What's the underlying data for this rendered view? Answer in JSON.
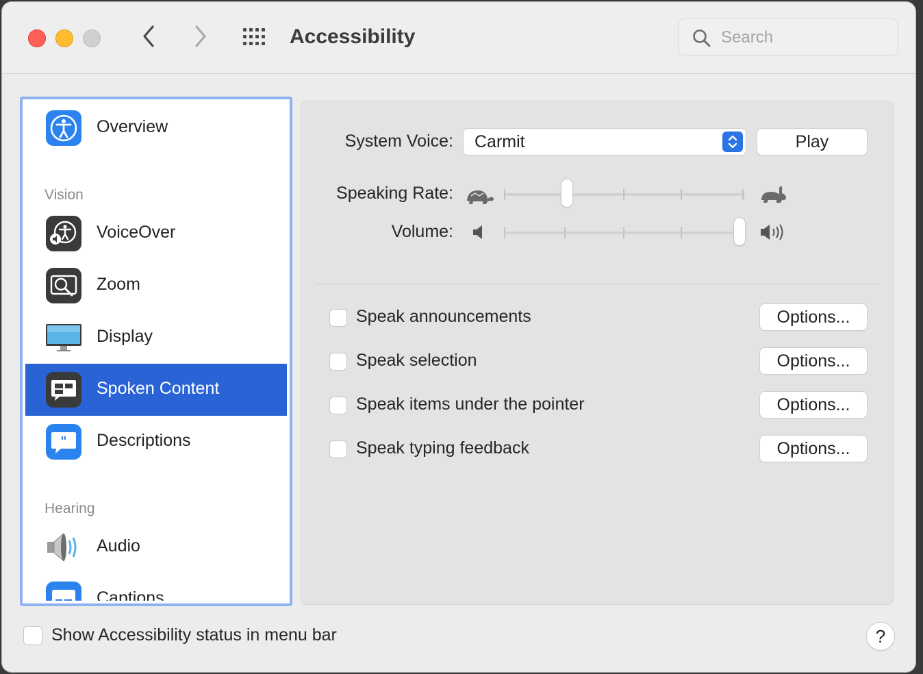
{
  "window": {
    "title": "Accessibility"
  },
  "search": {
    "placeholder": "Search"
  },
  "sidebar": {
    "items": [
      {
        "label": "Overview",
        "icon": "accessibility-icon"
      },
      {
        "section": "Vision"
      },
      {
        "label": "VoiceOver",
        "icon": "voiceover-icon"
      },
      {
        "label": "Zoom",
        "icon": "zoom-icon"
      },
      {
        "label": "Display",
        "icon": "display-icon"
      },
      {
        "label": "Spoken Content",
        "icon": "spoken-content-icon",
        "selected": true
      },
      {
        "label": "Descriptions",
        "icon": "descriptions-icon"
      },
      {
        "section": "Hearing"
      },
      {
        "label": "Audio",
        "icon": "speaker-icon"
      },
      {
        "label": "Captions",
        "icon": "captions-icon"
      }
    ]
  },
  "content": {
    "system_voice_label": "System Voice:",
    "system_voice_value": "Carmit",
    "play_label": "Play",
    "speaking_rate_label": "Speaking Rate:",
    "speaking_rate_value": 0.25,
    "volume_label": "Volume:",
    "volume_value": 1.0,
    "options": [
      {
        "label": "Speak announcements",
        "checked": false,
        "button": "Options..."
      },
      {
        "label": "Speak selection",
        "checked": false,
        "button": "Options..."
      },
      {
        "label": "Speak items under the pointer",
        "checked": false,
        "button": "Options..."
      },
      {
        "label": "Speak typing feedback",
        "checked": false,
        "button": "Options..."
      }
    ]
  },
  "footer": {
    "status_checkbox_label": "Show Accessibility status in menu bar",
    "status_checked": false,
    "help_label": "?"
  },
  "colors": {
    "accent": "#2a63d6",
    "selection_border": "#8eb1f1"
  }
}
